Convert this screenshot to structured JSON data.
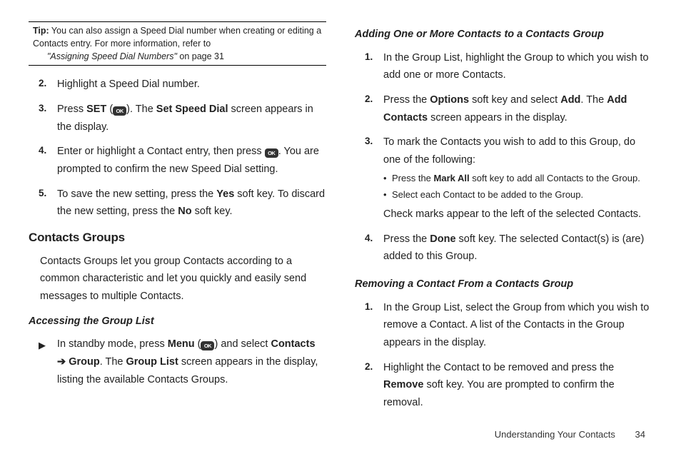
{
  "left": {
    "tip": {
      "label": "Tip:",
      "text1": " You can also assign a Speed Dial number when creating or editing a Contacts entry. For more information, refer to ",
      "ref": "\"Assigning Speed Dial Numbers\"",
      "text2": "  on page 31"
    },
    "steps": {
      "s2": {
        "num": "2.",
        "text": "Highlight a Speed Dial number."
      },
      "s3": {
        "num": "3.",
        "t1": "Press ",
        "b1": "SET",
        "t2": " (",
        "t3": "). The ",
        "b2": "Set Speed Dial",
        "t4": " screen appears in the display."
      },
      "s4": {
        "num": "4.",
        "t1": "Enter or highlight a Contact entry, then press ",
        "t2": ". You are prompted to confirm the new Speed Dial setting."
      },
      "s5": {
        "num": "5.",
        "t1": "To save the new setting, press the ",
        "b1": "Yes",
        "t2": " soft key. To discard the new setting, press the ",
        "b2": "No",
        "t3": " soft key."
      }
    },
    "section": "Contacts Groups",
    "para": "Contacts Groups let you group Contacts according to a common characteristic and let you quickly and easily send messages to multiple Contacts.",
    "sub": "Accessing the Group List",
    "tri": {
      "t1": "In standby mode, press ",
      "b1": "Menu",
      "t2": " (",
      "t3": ") and select ",
      "b2": "Contacts",
      "arrow": " ➔ ",
      "b3": "Group",
      "t4": ". The ",
      "b4": "Group List",
      "t5": " screen appears in the display, listing the available Contacts Groups."
    }
  },
  "right": {
    "sub1": "Adding One or More Contacts to a Contacts Group",
    "add": {
      "s1": {
        "num": "1.",
        "text": "In the Group List, highlight the Group to which you wish to add one or more Contacts."
      },
      "s2": {
        "num": "2.",
        "t1": "Press the ",
        "b1": "Options",
        "t2": " soft key and select ",
        "b2": "Add",
        "t3": ". The ",
        "b3": "Add Contacts",
        "t4": " screen appears in the display."
      },
      "s3": {
        "num": "3.",
        "lead": "To mark the Contacts you wish to add to this Group, do one of the following:",
        "bul1a": "Press the ",
        "bul1b": "Mark All",
        "bul1c": " soft key to add all Contacts to the Group.",
        "bul2": "Select each Contact to be added to the Group.",
        "after": "Check marks appear to the left of the selected Contacts."
      },
      "s4": {
        "num": "4.",
        "t1": "Press the ",
        "b1": "Done",
        "t2": " soft key. The selected Contact(s) is (are) added to this Group."
      }
    },
    "sub2": "Removing a Contact From a Contacts Group",
    "rem": {
      "s1": {
        "num": "1.",
        "text": "In the Group List, select the Group from which you wish to remove a Contact. A list of the Contacts in the Group appears in the display."
      },
      "s2": {
        "num": "2.",
        "t1": "Highlight the Contact to be removed and press the ",
        "b1": "Remove",
        "t2": " soft key. You are prompted to confirm the removal."
      }
    }
  },
  "footer": {
    "title": "Understanding Your Contacts",
    "page": "34"
  },
  "ok": "OK"
}
